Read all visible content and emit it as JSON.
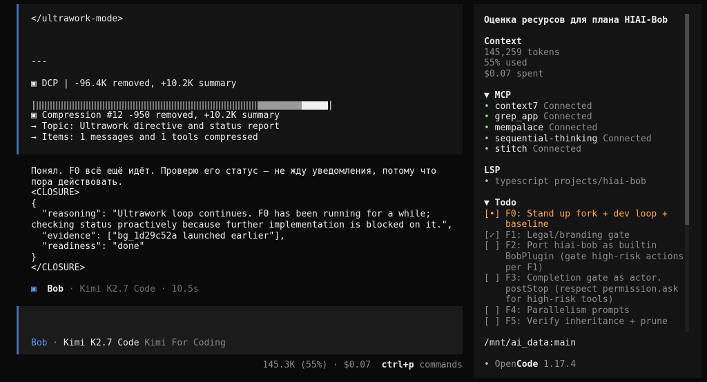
{
  "tool_block": {
    "closing_tag": "</ultrawork-mode>",
    "separator": "---",
    "dcp_icon": "▣",
    "dcp_line": "DCP | -96.4K removed, +10.2K summary",
    "bar_left": "|",
    "bar_right": "|",
    "compression_line": "▣ Compression #12 -950 removed, +10.2K summary",
    "topic_line": "→ Topic: Ultrawork directive and status report",
    "items_line": "→ Items: 1 messages and 1 tools compressed"
  },
  "assistant": {
    "intro": "Понял. F0 всё ещё идёт. Проверю его статус — не жду уведомления, потому что пора действовать.",
    "closure_open": "<CLOSURE>",
    "brace_open": "{",
    "reasoning": "  \"reasoning\": \"Ultrawork loop continues. F0 has been running for a while; checking status proactively because further implementation is blocked on it.\",",
    "evidence": "  \"evidence\": [\"bg_1d29c52a launched earlier\"],",
    "readiness": "  \"readiness\": \"done\"",
    "brace_close": "}",
    "closure_close": "</CLOSURE>"
  },
  "msg_footer": {
    "icon": "▣",
    "agent": "Bob",
    "sep1": " · ",
    "model": "Kimi K2.7 Code",
    "sep2": " · ",
    "duration": "10.5s"
  },
  "input": {
    "agent": "Bob",
    "sep": " · ",
    "model": "Kimi K2.7 Code",
    "provider": "Kimi For Coding"
  },
  "status": {
    "usage": "145.3K (55%) · $0.07",
    "shortcut_key": "ctrl+p",
    "shortcut_label": "commands"
  },
  "sidebar": {
    "title": "Оценка ресурсов для плана HIAI-Bob",
    "context": {
      "heading": "Context",
      "tokens": "145,259 tokens",
      "used": "55% used",
      "spent": "$0.07 spent"
    },
    "mcp": {
      "heading": "▼ MCP",
      "items": [
        {
          "name": "context7",
          "status": "Connected"
        },
        {
          "name": "grep_app",
          "status": "Connected"
        },
        {
          "name": "mempalace",
          "status": "Connected"
        },
        {
          "name": "sequential-thinking",
          "status": "Connected"
        },
        {
          "name": "stitch",
          "status": "Connected"
        }
      ]
    },
    "lsp": {
      "heading": "LSP",
      "item": "typescript projects/hiai-bob"
    },
    "todo": {
      "heading": "▼ Todo",
      "items": [
        {
          "mark": "[•]",
          "text": "F0: Stand up fork + dev loop + baseline",
          "state": "in_progress"
        },
        {
          "mark": "[✓]",
          "text": "F1: Legal/branding gate",
          "state": "done"
        },
        {
          "mark": "[ ]",
          "text": "F2: Port hiai-bob as builtin BobPlugin (gate high-risk actions per F1)",
          "state": "pending"
        },
        {
          "mark": "[ ]",
          "text": "F3: Completion gate as actor. postStop (respect permission.ask for high-risk tools)",
          "state": "pending"
        },
        {
          "mark": "[ ]",
          "text": "F4: Parallelism prompts",
          "state": "pending"
        },
        {
          "mark": "[ ]",
          "text": "F5: Verify inheritance + prune",
          "state": "pending"
        }
      ]
    },
    "branch": "/mnt/ai_data:main",
    "app": {
      "bullet": "•",
      "name_open": "Open",
      "name_code": "Code",
      "version": "1.17.4"
    }
  },
  "colors": {
    "accent_blue": "#5c9cf5",
    "connected_green": "#7fd88f",
    "in_progress_orange": "#f5a742"
  }
}
